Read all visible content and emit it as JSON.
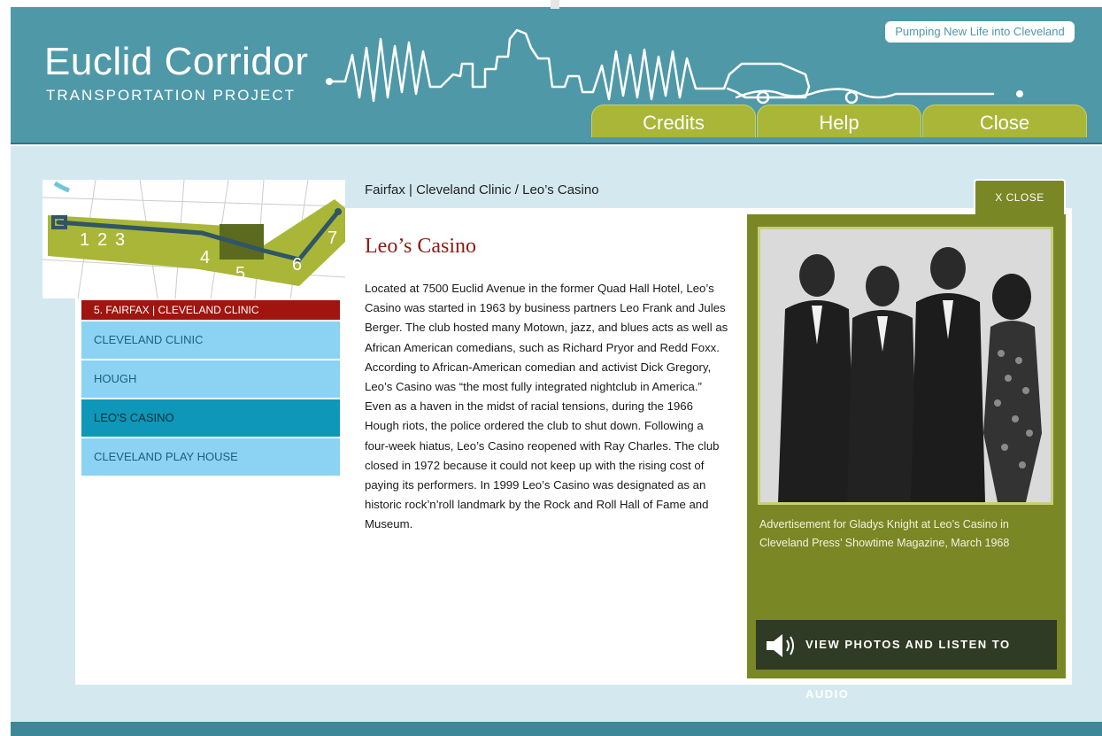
{
  "header": {
    "title": "Euclid Corridor",
    "subtitle": "TRANSPORTATION PROJECT",
    "tagline": "Pumping New Life into Cleveland",
    "tabs": [
      {
        "label": "Credits"
      },
      {
        "label": "Help"
      },
      {
        "label": "Close"
      }
    ]
  },
  "map": {
    "stations": [
      "1",
      "2",
      "3",
      "4",
      "5",
      "6",
      "7"
    ],
    "section_label": "5. FAIRFAX | CLEVELAND CLINIC"
  },
  "sidebar": {
    "items": [
      {
        "label": "CLEVELAND CLINIC",
        "active": false
      },
      {
        "label": "HOUGH",
        "active": false
      },
      {
        "label": "LEO'S CASINO",
        "active": true
      },
      {
        "label": "CLEVELAND PLAY HOUSE",
        "active": false
      }
    ]
  },
  "content": {
    "breadcrumb": "Fairfax | Cleveland Clinic / Leo’s Casino",
    "title": "Leo’s Casino",
    "body": "Located at 7500 Euclid Avenue in the former Quad Hall Hotel, Leo’s Casino was started in 1963 by business partners Leo Frank and Jules Berger.  The club hosted many Motown, jazz, and blues acts as well as African American comedians, such as Richard Pryor and Redd Foxx.  According to African-American comedian and activist Dick Gregory, Leo’s Casino was “the most fully integrated nightclub in America.”  Even as a haven in the midst of racial tensions, during the 1966 Hough riots, the police ordered the club to shut down.  Following a four-week hiatus, Leo’s Casino reopened with Ray Charles. The club closed in 1972 because it could not keep up with the rising cost of paying its performers.  In 1999 Leo’s Casino was designated as an historic rock’n’roll landmark by the Rock and Roll Hall of Fame and Museum."
  },
  "media_panel": {
    "close_label": "X  CLOSE",
    "caption": "Advertisement for Gladys Knight at Leo’s Casino in Cleveland Press’ Showtime Magazine, March 1968",
    "audio_button_label": "VIEW PHOTOS AND LISTEN TO AUDIO"
  },
  "colors": {
    "header_teal": "#4f98a8",
    "tab_green": "#a9b638",
    "olive_panel": "#7a8725",
    "title_red": "#8a1c12",
    "nav_light": "#8bd2f3",
    "nav_active": "#0e97b8"
  }
}
